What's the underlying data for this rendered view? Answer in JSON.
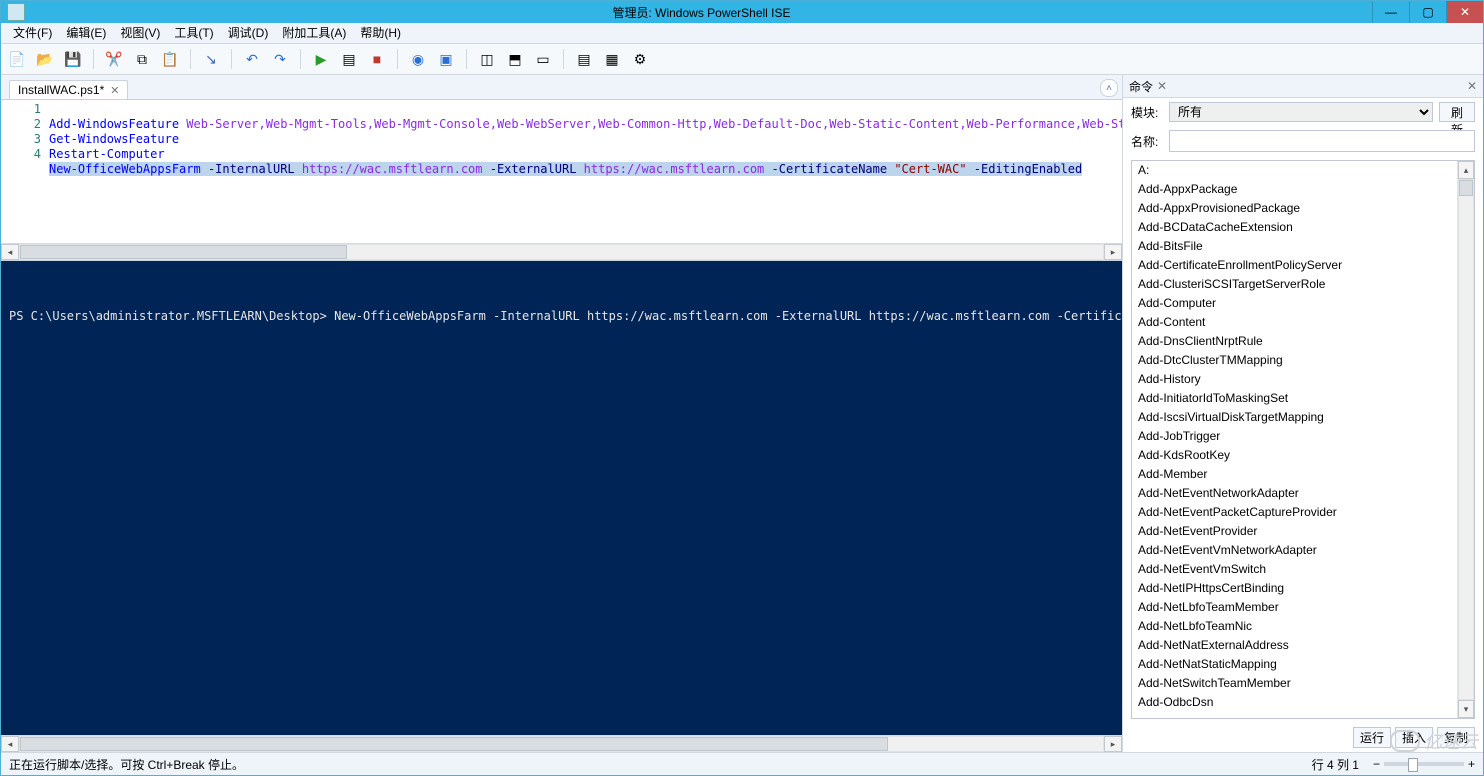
{
  "window": {
    "title": "管理员: Windows PowerShell ISE",
    "min": "—",
    "max": "▢",
    "close": "✕"
  },
  "menu": [
    "文件(F)",
    "编辑(E)",
    "视图(V)",
    "工具(T)",
    "调试(D)",
    "附加工具(A)",
    "帮助(H)"
  ],
  "tab": {
    "name": "InstallWAC.ps1*",
    "close": "✕"
  },
  "code": {
    "lines": [
      "1",
      "2",
      "3",
      "4"
    ],
    "l1_cmd": "Add-WindowsFeature",
    "l1_args": "Web-Server,Web-Mgmt-Tools,Web-Mgmt-Console,Web-WebServer,Web-Common-Http,Web-Default-Doc,Web-Static-Content,Web-Performance,Web-Stat-Compression,Web-Dyn",
    "l2_cmd": "Get-WindowsFeature",
    "l3_cmd": "Restart-Computer",
    "l4_cmd": "New-OfficeWebAppsFarm",
    "l4_p1": " -InternalURL ",
    "l4_a1": "https://wac.msftlearn.com",
    "l4_p2": " -ExternalURL ",
    "l4_a2": "https://wac.msftlearn.com",
    "l4_p3": " -CertificateName ",
    "l4_a3": "\"Cert-WAC\"",
    "l4_p4": " -EditingEnabled"
  },
  "console": {
    "line": "PS C:\\Users\\administrator.MSFTLEARN\\Desktop> New-OfficeWebAppsFarm -InternalURL https://wac.msftlearn.com -ExternalURL https://wac.msftlearn.com -CertificateName \"Cert-WAC\" -Edi"
  },
  "panel": {
    "title": "命令",
    "close": "✕",
    "module_label": "模块:",
    "module_value": "所有",
    "refresh": "刷新",
    "name_label": "名称:",
    "name_value": "",
    "items": [
      "A:",
      "Add-AppxPackage",
      "Add-AppxProvisionedPackage",
      "Add-BCDataCacheExtension",
      "Add-BitsFile",
      "Add-CertificateEnrollmentPolicyServer",
      "Add-ClusteriSCSITargetServerRole",
      "Add-Computer",
      "Add-Content",
      "Add-DnsClientNrptRule",
      "Add-DtcClusterTMMapping",
      "Add-History",
      "Add-InitiatorIdToMaskingSet",
      "Add-IscsiVirtualDiskTargetMapping",
      "Add-JobTrigger",
      "Add-KdsRootKey",
      "Add-Member",
      "Add-NetEventNetworkAdapter",
      "Add-NetEventPacketCaptureProvider",
      "Add-NetEventProvider",
      "Add-NetEventVmNetworkAdapter",
      "Add-NetEventVmSwitch",
      "Add-NetIPHttpsCertBinding",
      "Add-NetLbfoTeamMember",
      "Add-NetLbfoTeamNic",
      "Add-NetNatExternalAddress",
      "Add-NetNatStaticMapping",
      "Add-NetSwitchTeamMember",
      "Add-OdbcDsn"
    ],
    "run": "运行",
    "insert": "插入",
    "copy": "复制"
  },
  "status": {
    "text": "正在运行脚本/选择。可按 Ctrl+Break 停止。",
    "pos": "行 4 列 1"
  },
  "watermark": "亿速云"
}
